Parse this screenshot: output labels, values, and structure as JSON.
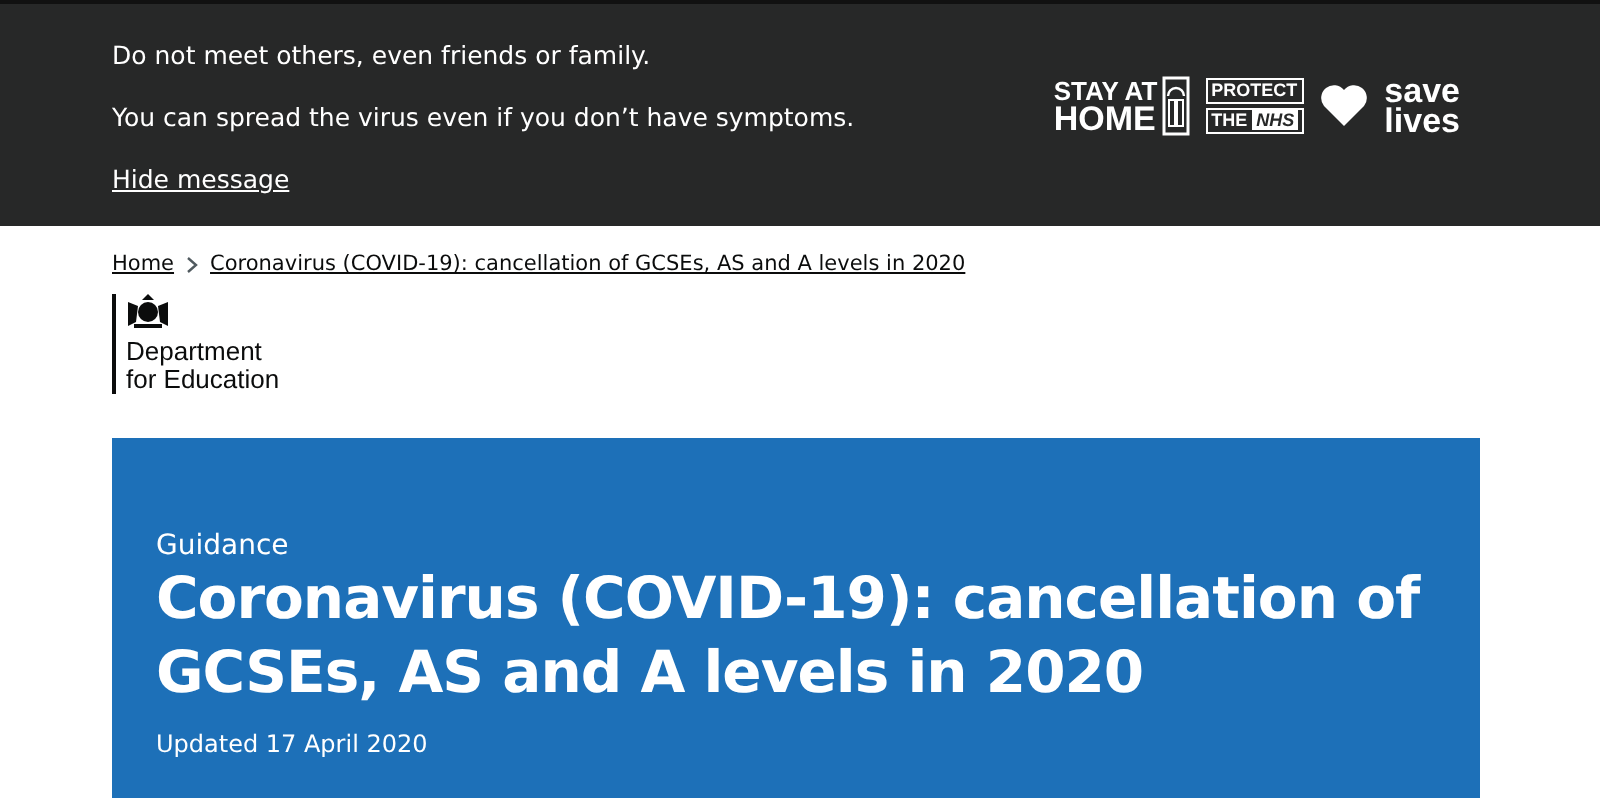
{
  "banner": {
    "lines": [
      "Do not meet others, even friends or family.",
      "You can spread the virus even if you don’t have symptoms."
    ],
    "hide_link": "Hide message",
    "logos": {
      "stay_at_home": [
        "STAY AT",
        "HOME"
      ],
      "protect": [
        "PROTECT",
        "THE",
        "NHS"
      ],
      "save": [
        "save",
        "lives"
      ]
    }
  },
  "breadcrumbs": [
    "Home",
    "Coronavirus (COVID-19): cancellation of GCSEs, AS and A levels in 2020"
  ],
  "organisation": {
    "lines": [
      "Department",
      "for Education"
    ]
  },
  "header": {
    "type": "Guidance",
    "title": "Coronavirus (COVID-19): cancellation of GCSEs, AS and A levels in 2020",
    "updated": "Updated 17 April 2020"
  }
}
